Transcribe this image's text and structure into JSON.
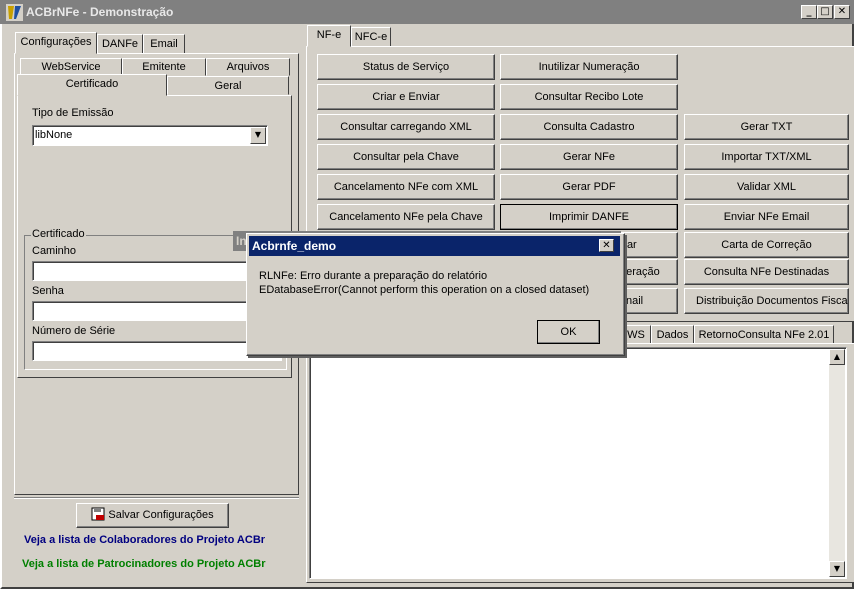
{
  "window": {
    "title": "ACBrNFe - Demonstração",
    "min": "_",
    "max": "□",
    "close": "✕"
  },
  "left": {
    "tabs": [
      "Configurações",
      "DANFe",
      "Email"
    ],
    "subtabs_row1": [
      "WebService",
      "Emitente",
      "Arquivos"
    ],
    "subtabs_row2": [
      "Certificado",
      "Geral"
    ],
    "tipo_emissao_label": "Tipo de Emissão",
    "tipo_emissao_value": "libNone",
    "cert_group_label": "Certificado",
    "caminho_label": "Caminho",
    "senha_label": "Senha",
    "numserie_label": "Número de Série",
    "save_label": "Salvar Configurações",
    "link_colab": "Veja a lista de Colaboradores do Projeto ACBr",
    "link_patro": "Veja a lista de Patrocinadores do Projeto ACBr"
  },
  "right": {
    "tabs": [
      "NF-e",
      "NFC-e"
    ],
    "buttons": [
      [
        "Status de Serviço",
        "Inutilizar Numeração",
        ""
      ],
      [
        "Criar e Enviar",
        "Consultar Recibo Lote",
        ""
      ],
      [
        "Consultar carregando XML",
        "Consulta Cadastro",
        "Gerar TXT"
      ],
      [
        "Consultar pela Chave",
        "Gerar NFe",
        "Importar TXT/XML"
      ],
      [
        "Cancelamento NFe com XML",
        "Gerar PDF",
        "Validar XML"
      ],
      [
        "Cancelamento NFe pela Chave",
        "Imprimir DANFE",
        "Enviar NFe Email"
      ],
      [
        "",
        "viar",
        "Carta de Correção"
      ],
      [
        "",
        "peração",
        "Consulta NFe Destinadas"
      ],
      [
        "",
        "nail",
        "Distribuição Documentos Fiscais"
      ]
    ],
    "result_tabs": [
      "WS",
      "Dados",
      "RetornoConsulta NFe 2.01"
    ],
    "scroll_up": "▲",
    "scroll_down": "▼"
  },
  "dialog": {
    "title": "Acbrnfe_demo",
    "line1": "RLNFe: Erro durante a preparação do relatório",
    "line2": "EDatabaseError(Cannot perform this operation on a closed dataset)",
    "ok": "OK",
    "behind_title_fragment": "In"
  }
}
